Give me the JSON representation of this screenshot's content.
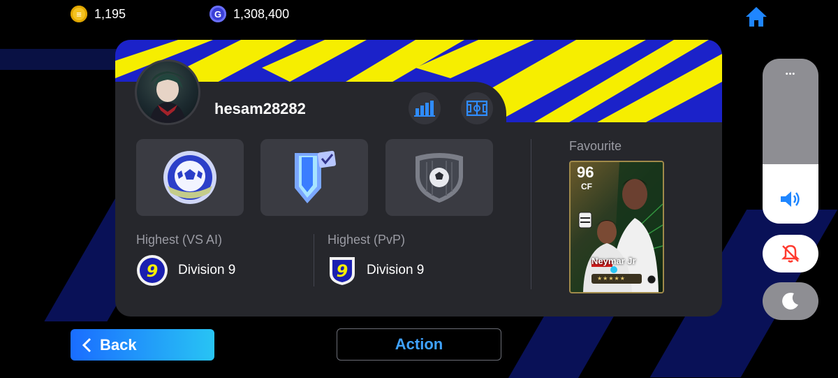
{
  "currency": {
    "coins": "1,195",
    "gp": "1,308,400",
    "gp_symbol": "G"
  },
  "profile": {
    "username": "hesam28282"
  },
  "highest": {
    "vs_ai_label": "Highest (VS AI)",
    "vs_ai_division_number": "9",
    "vs_ai_division": "Division 9",
    "pvp_label": "Highest (PvP)",
    "pvp_division_number": "9",
    "pvp_division": "Division 9"
  },
  "favourite": {
    "label": "Favourite",
    "rating": "96",
    "position": "CF",
    "player_name": "Neymar Jr",
    "stars": "★★★★★"
  },
  "buttons": {
    "back": "Back",
    "action": "Action"
  },
  "controls": {
    "more": "•••",
    "volume_level": 0.36
  },
  "colors": {
    "banner_yellow": "#f6ee00",
    "banner_blue": "#1b22c9",
    "accent_blue": "#3fa2ff",
    "mute_red": "#ff3b30"
  },
  "icons": {
    "home": "home-icon",
    "stats": "bar-chart-icon",
    "pitch": "pitch-icon",
    "volume": "speaker-icon",
    "mute": "bell-slash-icon",
    "dark_mode": "moon-icon"
  }
}
